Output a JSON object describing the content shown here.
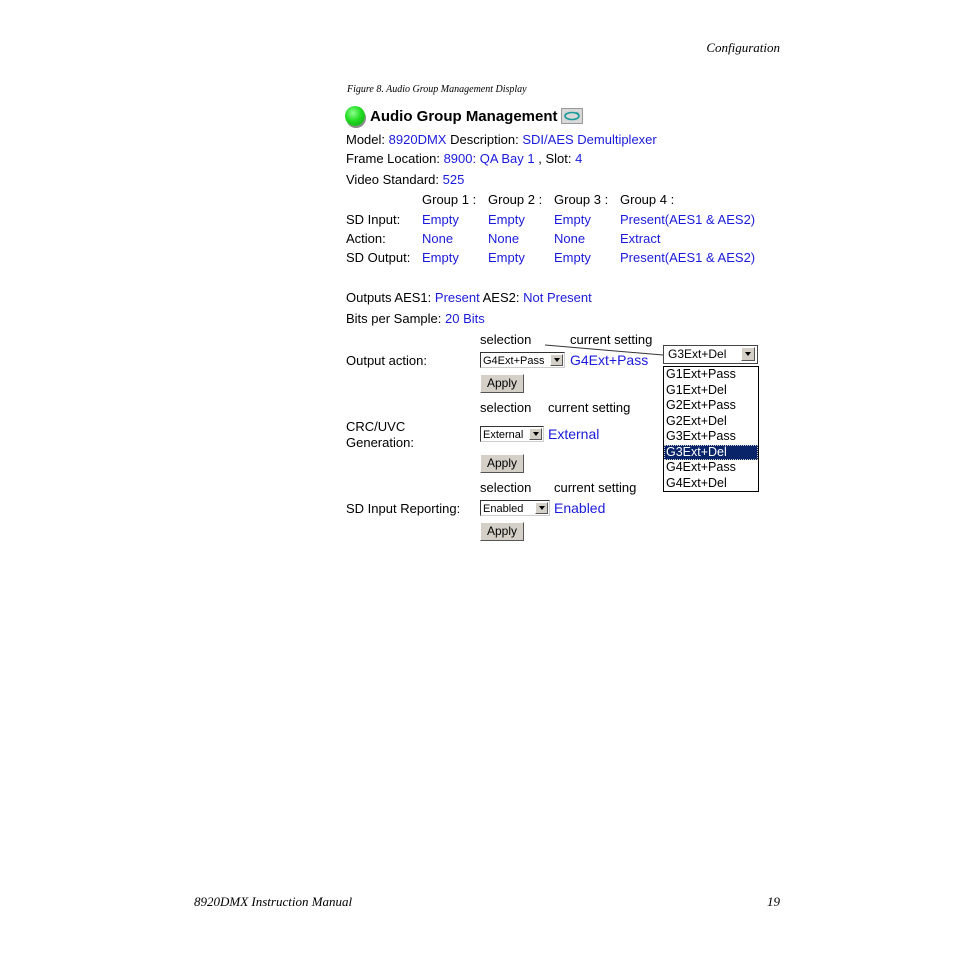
{
  "page": {
    "header": "Configuration",
    "caption": "Figure 8.  Audio Group Management Display",
    "footer_left": "8920DMX Instruction Manual",
    "footer_right": "19"
  },
  "panel": {
    "title": "Audio Group Management",
    "status_icon": "green-led-icon",
    "refresh_icon": "refresh-icon",
    "model_label": "Model:",
    "model_value": "8920DMX",
    "description_label": "Description:",
    "description_value": "SDI/AES Demultiplexer",
    "frame_label": "Frame Location:",
    "frame_value": "8900: QA Bay 1",
    "slot_label": ", Slot:",
    "slot_value": "4",
    "video_label": "Video Standard:",
    "video_value": "525",
    "groups": {
      "headers": [
        "Group 1 :",
        "Group 2 :",
        "Group 3 :",
        "Group 4 :"
      ],
      "rows": [
        {
          "label": "SD Input:",
          "values": [
            "Empty",
            "Empty",
            "Empty",
            "Present(AES1 & AES2)"
          ]
        },
        {
          "label": "Action:",
          "values": [
            "None",
            "None",
            "None",
            "Extract"
          ]
        },
        {
          "label": "SD Output:",
          "values": [
            "Empty",
            "Empty",
            "Empty",
            "Present(AES1 & AES2)"
          ]
        }
      ]
    },
    "outputs_label": "Outputs AES1:",
    "outputs_aes1": "Present",
    "outputs_aes2_label": "AES2:",
    "outputs_aes2": "Not Present",
    "bits_label": "Bits per Sample:",
    "bits_value": "20 Bits",
    "selection_label": "selection",
    "current_label": "current setting",
    "apply_label": "Apply",
    "output_action": {
      "label": "Output action:",
      "selected": "G4Ext+Pass",
      "current": "G4Ext+Pass"
    },
    "crc": {
      "label_line1": "CRC/UVC",
      "label_line2": "Generation:",
      "selected": "External",
      "current": "External"
    },
    "sd_reporting": {
      "label": "SD Input Reporting:",
      "selected": "Enabled",
      "current": "Enabled"
    },
    "callout_dropdown": {
      "selected": "G3Ext+Del",
      "options": [
        "G1Ext+Pass",
        "G1Ext+Del",
        "G2Ext+Pass",
        "G2Ext+Del",
        "G3Ext+Pass",
        "G3Ext+Del",
        "G4Ext+Pass",
        "G4Ext+Del"
      ],
      "highlighted_index": 5
    }
  }
}
